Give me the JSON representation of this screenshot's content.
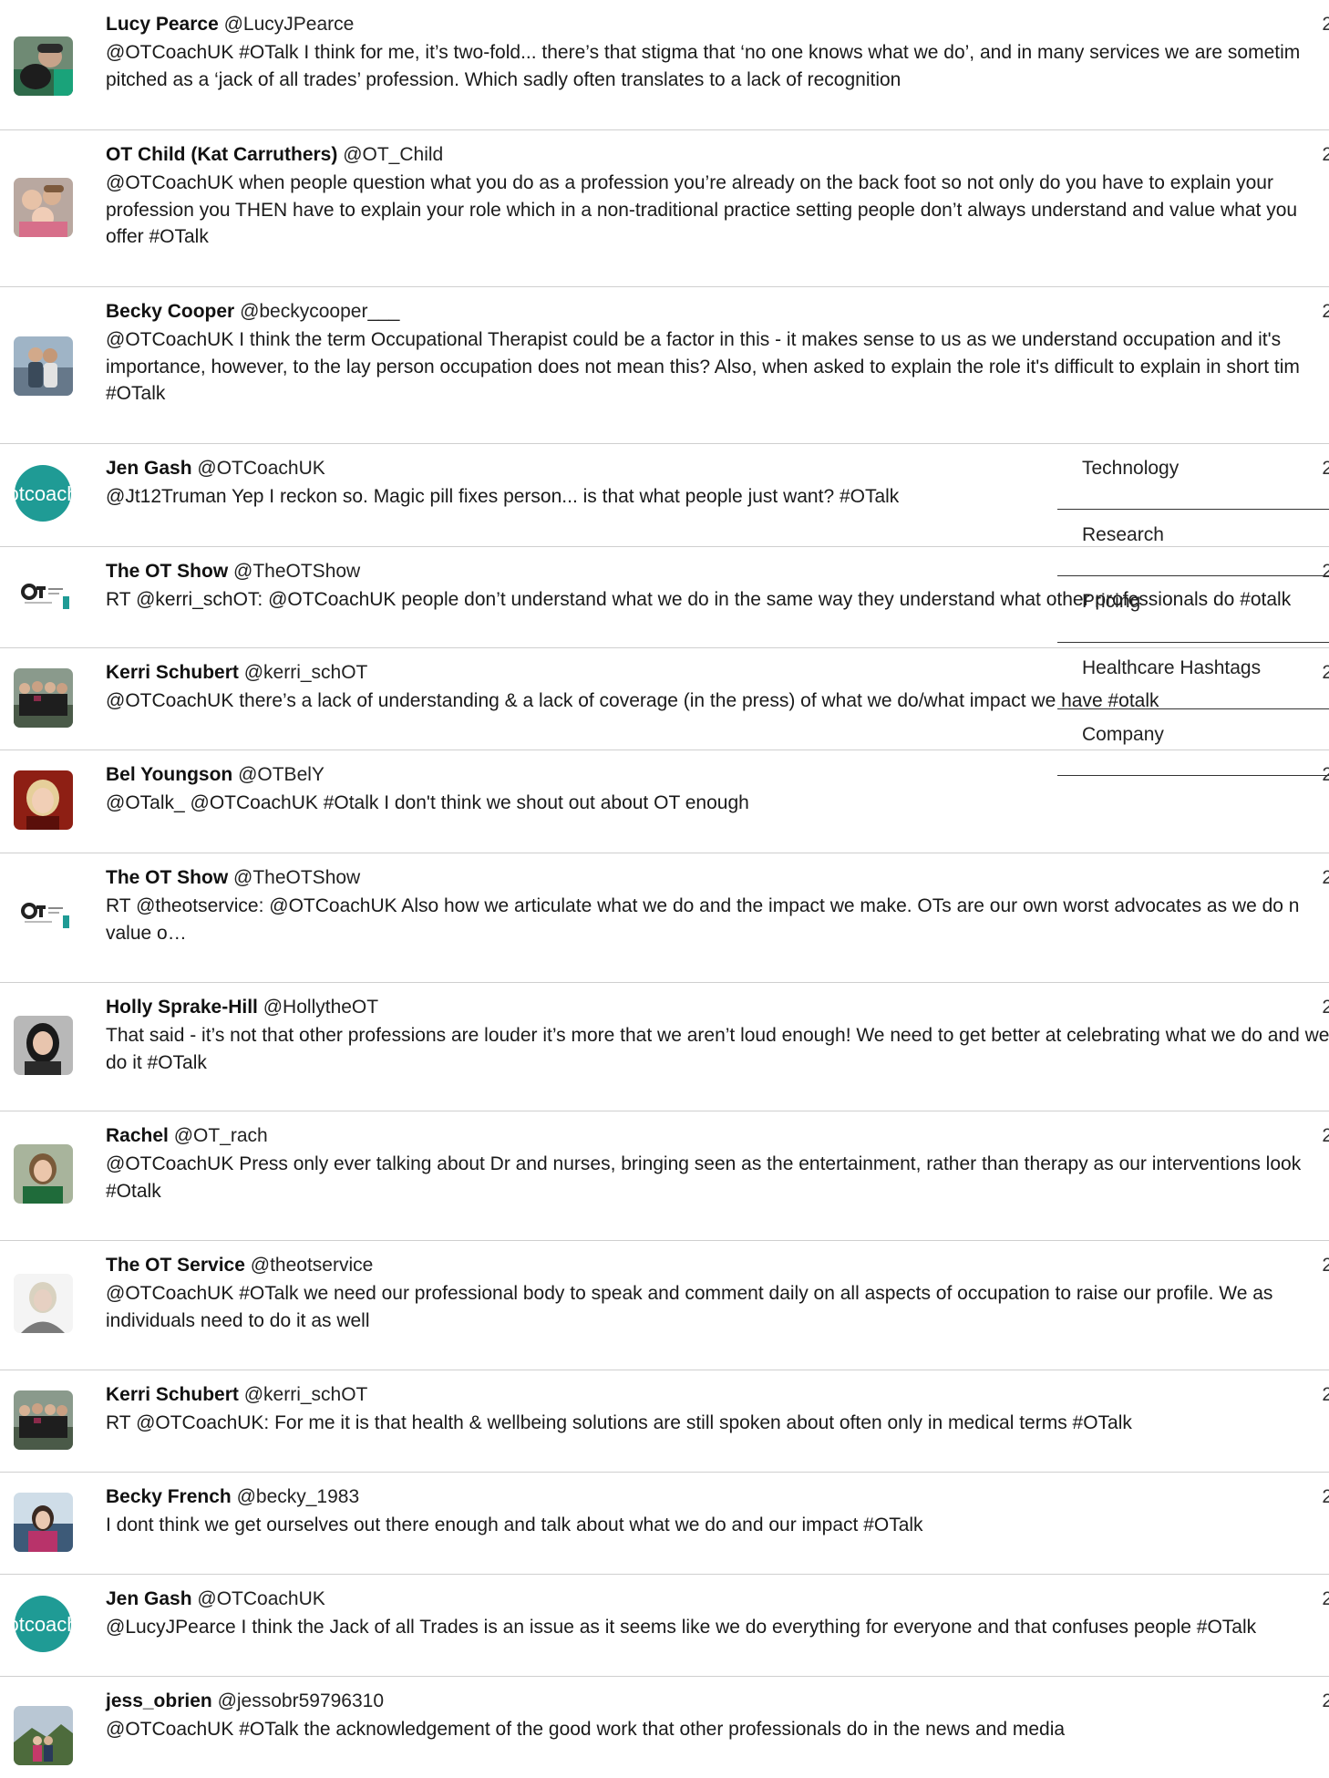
{
  "tweets": [
    {
      "name": "Lucy Pearce",
      "handle": "@LucyJPearce",
      "time": "2",
      "text": "@OTCoachUK #OTalk I think for me, it’s two-fold... there’s that stigma that ‘no one knows what we do’, and in many services we are sometim pitched as a ‘jack of all trades’ profession. Which sadly often translates to a lack of recognition",
      "avatar": "photo-avatar-dog"
    },
    {
      "name": "OT Child (Kat Carruthers)",
      "handle": "@OT_Child",
      "time": "2",
      "text": "@OTCoachUK when people question what you do as a profession you’re already on the back foot so not only do you have to explain your profession you THEN have to explain your role which in a non-traditional practice setting people don’t always understand and value what you offer #OTalk",
      "avatar": "photo-avatar-family"
    },
    {
      "name": "Becky Cooper",
      "handle": "@beckycooper___",
      "time": "2",
      "text": "@OTCoachUK I think the term Occupational Therapist could be a factor in this - it makes sense to us as we understand occupation and it's importance, however, to the lay person occupation does not mean this? Also, when asked to explain the role it's difficult to explain in short tim #OTalk",
      "avatar": "photo-avatar-couple"
    },
    {
      "name": "Jen Gash",
      "handle": "@OTCoachUK",
      "time": "2",
      "text": "@Jt12Truman Yep I reckon so. Magic pill fixes person... is that what people just want? #OTalk",
      "avatar": "otcoach-logo"
    },
    {
      "name": "The OT Show",
      "handle": "@TheOTShow",
      "time": "2",
      "text": "RT @kerri_schOT: @OTCoachUK people don’t understand what we do in the same way they understand what other professionals do #otalk",
      "avatar": "ot-show-logo"
    },
    {
      "name": "Kerri Schubert",
      "handle": "@kerri_schOT",
      "time": "2",
      "text": "@OTCoachUK there’s a lack of understanding & a lack of coverage (in the press) of what we do/what impact we have #otalk",
      "avatar": "photo-avatar-group"
    },
    {
      "name": "Bel Youngson",
      "handle": "@OTBelY",
      "time": "2",
      "text": "@OTalk_ @OTCoachUK #Otalk I don't think we shout out about OT enough",
      "avatar": "photo-avatar-woman-red"
    },
    {
      "name": "The OT Show",
      "handle": "@TheOTShow",
      "time": "2",
      "text": "RT @theotservice: @OTCoachUK Also how we articulate what we do and the impact we make. OTs are our own worst advocates as we do n value o…",
      "avatar": "ot-show-logo"
    },
    {
      "name": "Holly Sprake-Hill",
      "handle": "@HollytheOT",
      "time": "2",
      "text": "That said - it’s not that other professions are louder it’s more that we aren’t loud enough! We need to get better at celebrating what we do and we do it #OTalk",
      "avatar": "photo-avatar-woman-dark"
    },
    {
      "name": "Rachel",
      "handle": "@OT_rach",
      "time": "2",
      "text": "@OTCoachUK Press only ever talking about Dr and nurses, bringing seen as the entertainment, rather than therapy as our interventions look #Otalk",
      "avatar": "photo-avatar-woman-green"
    },
    {
      "name": "The OT Service",
      "handle": "@theotservice",
      "time": "2",
      "text": "@OTCoachUK #OTalk we need our professional body to speak and comment daily on all aspects of occupation to raise our profile. We as individuals need to do it as well",
      "avatar": "photo-avatar-woman-grey"
    },
    {
      "name": "Kerri Schubert",
      "handle": "@kerri_schOT",
      "time": "2",
      "text": "RT @OTCoachUK: For me it is that health & wellbeing solutions are still spoken about often only in medical terms #OTalk",
      "avatar": "photo-avatar-group"
    },
    {
      "name": "Becky French",
      "handle": "@becky_1983",
      "time": "2",
      "text": "I dont think we get ourselves out there enough and talk about what we do and our impact #OTalk",
      "avatar": "photo-avatar-woman-snow"
    },
    {
      "name": "Jen Gash",
      "handle": "@OTCoachUK",
      "time": "2",
      "text": "@LucyJPearce I think the Jack of all Trades is an issue as it seems like we do everything for everyone and that confuses people #OTalk",
      "avatar": "otcoach-logo"
    },
    {
      "name": "jess_obrien",
      "handle": "@jessobr59796310",
      "time": "2",
      "text": "@OTCoachUK #OTalk the acknowledgement of the good work that other professionals do in the news and media",
      "avatar": "photo-avatar-landscape"
    }
  ],
  "logo_text": "otcoach",
  "menu": {
    "items": [
      {
        "label": "Technology"
      },
      {
        "label": "Research"
      },
      {
        "label": "Pricing"
      },
      {
        "label": "Healthcare Hashtags"
      },
      {
        "label": "Company"
      }
    ]
  },
  "colors": {
    "otcoach_teal": "#1f9b95",
    "divider": "#cfcfcf",
    "text": "#1a1a1a"
  }
}
